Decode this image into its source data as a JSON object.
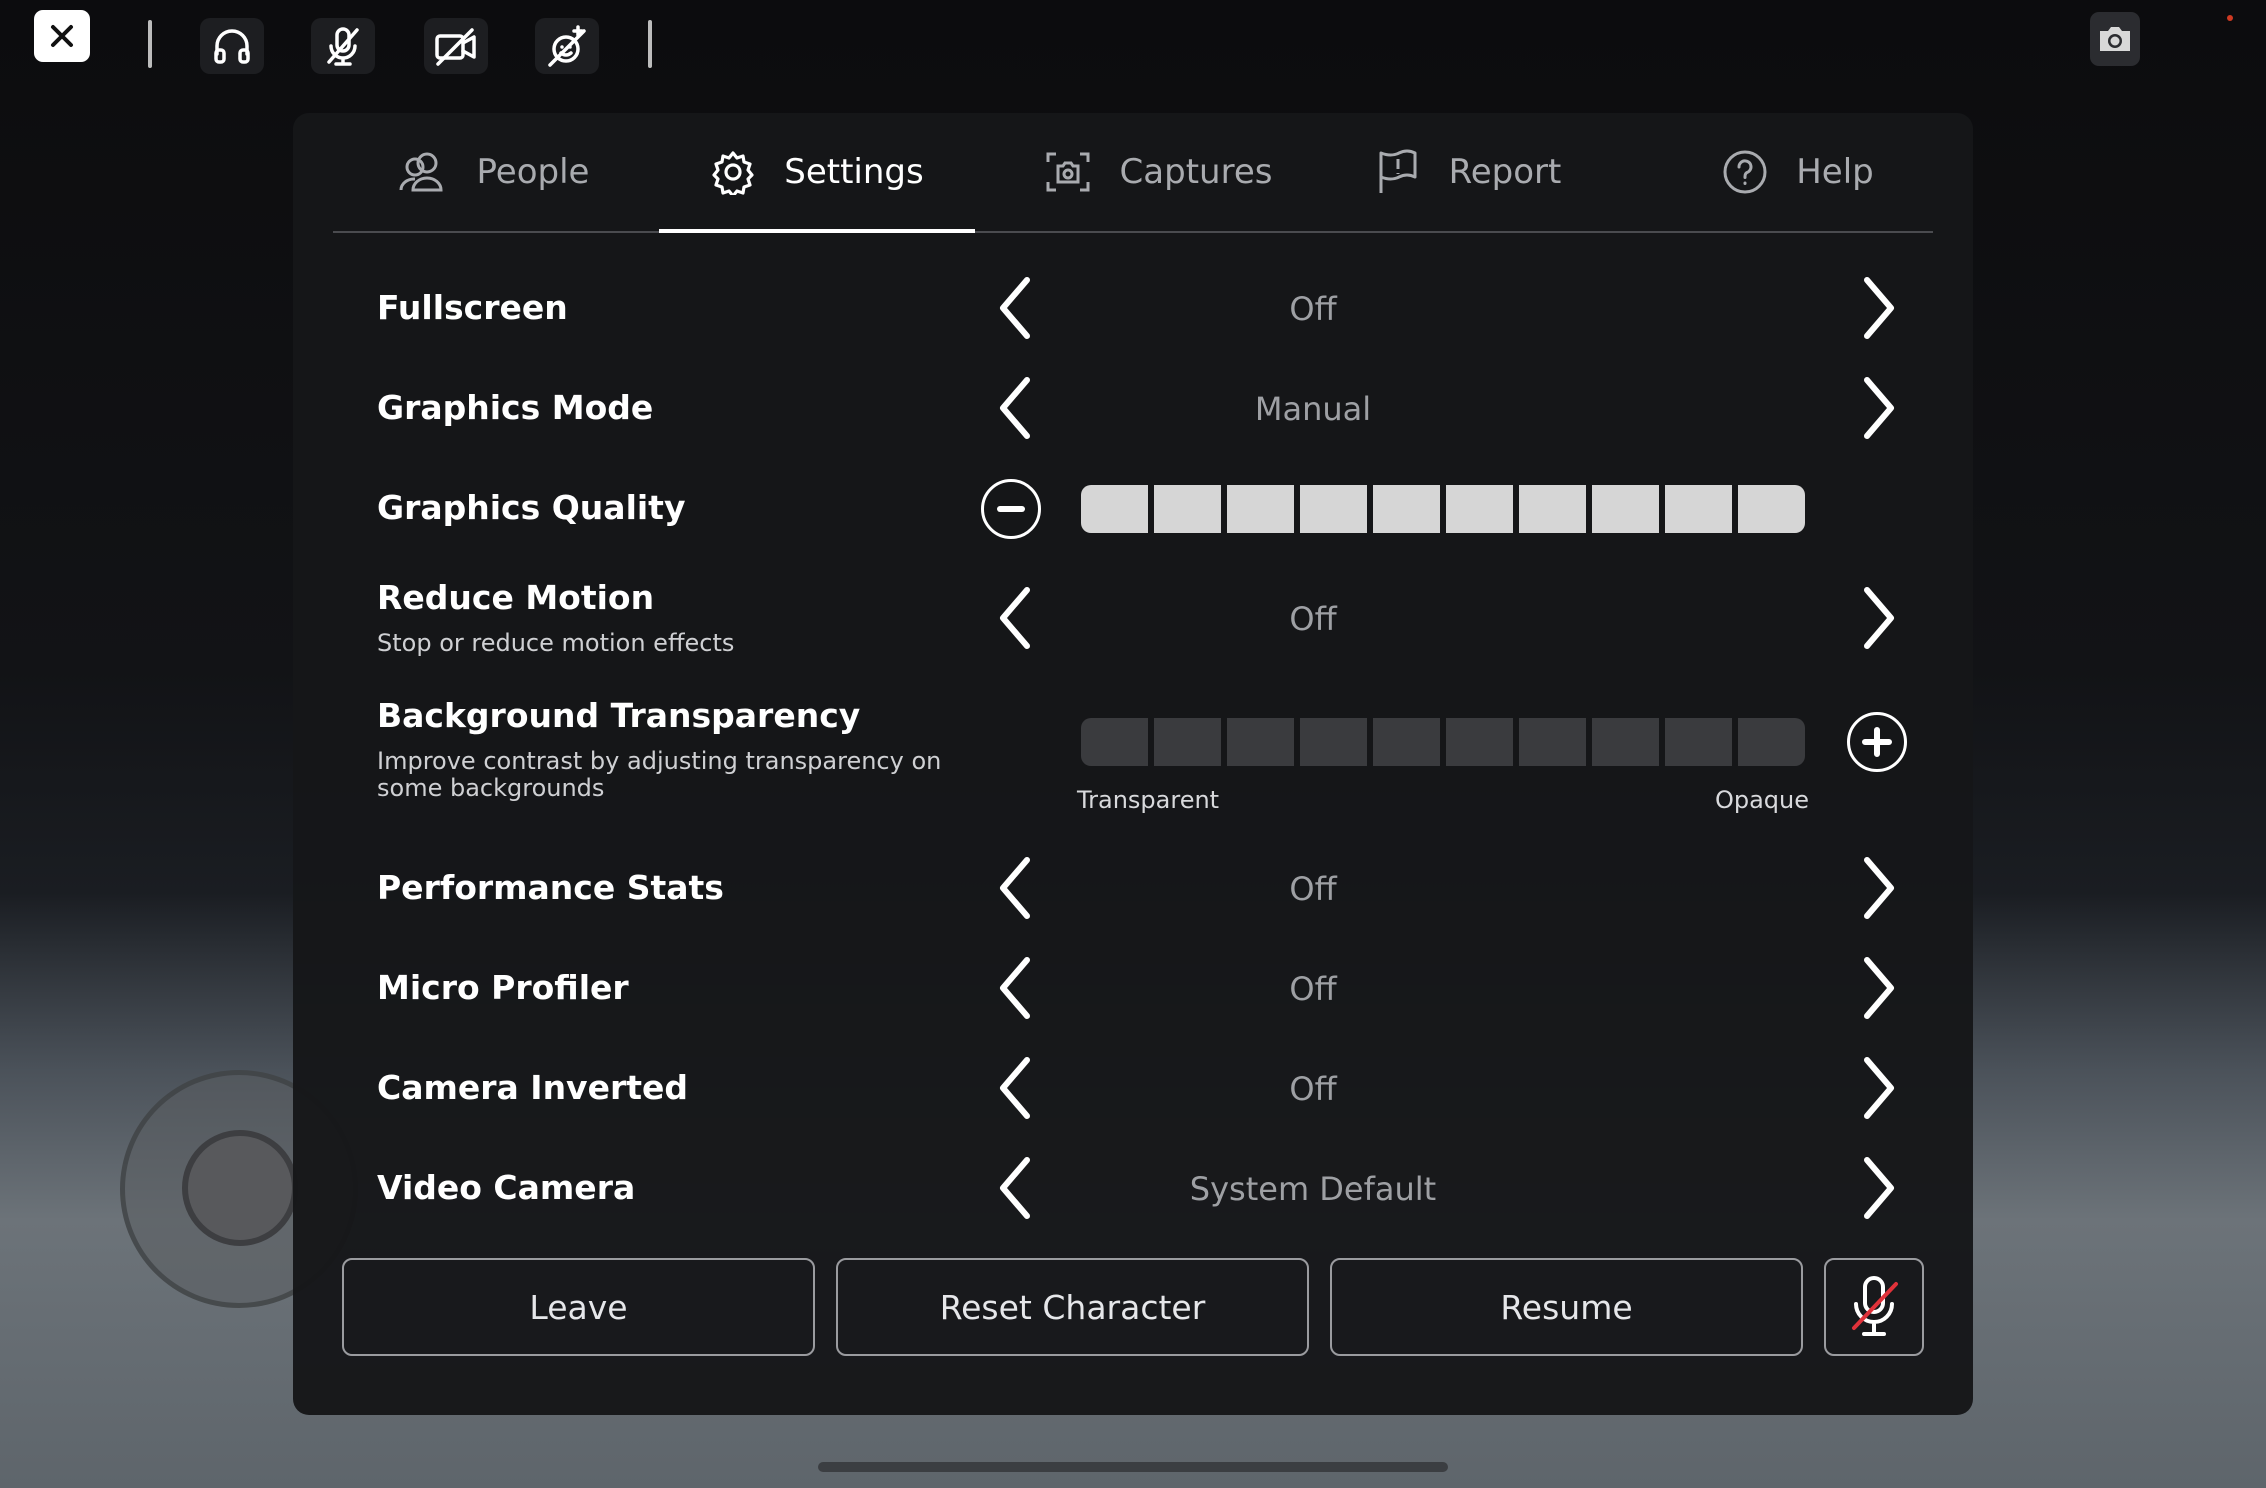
{
  "tabs": [
    {
      "label": "People",
      "icon": "people-icon"
    },
    {
      "label": "Settings",
      "icon": "gear-icon"
    },
    {
      "label": "Captures",
      "icon": "capture-icon"
    },
    {
      "label": "Report",
      "icon": "flag-icon"
    },
    {
      "label": "Help",
      "icon": "help-icon"
    }
  ],
  "active_tab": "Settings",
  "settings": {
    "fullscreen": {
      "label": "Fullscreen",
      "value": "Off"
    },
    "graphics_mode": {
      "label": "Graphics Mode",
      "value": "Manual"
    },
    "graphics_quality": {
      "label": "Graphics Quality",
      "level": 10,
      "max": 10
    },
    "reduce_motion": {
      "label": "Reduce Motion",
      "description": "Stop or reduce motion effects",
      "value": "Off"
    },
    "background_transparency": {
      "label": "Background Transparency",
      "description": "Improve contrast by adjusting transparency on some backgrounds",
      "level": 0,
      "max": 10,
      "min_label": "Transparent",
      "max_label": "Opaque"
    },
    "performance_stats": {
      "label": "Performance Stats",
      "value": "Off"
    },
    "micro_profiler": {
      "label": "Micro Profiler",
      "value": "Off"
    },
    "camera_inverted": {
      "label": "Camera Inverted",
      "value": "Off"
    },
    "video_camera": {
      "label": "Video Camera",
      "value": "System Default"
    }
  },
  "buttons": {
    "leave": "Leave",
    "reset_character": "Reset Character",
    "resume": "Resume"
  },
  "colors": {
    "panel_bg": "#161719",
    "slider_on": "#d6d6d6",
    "slider_off": "#3a3b3e",
    "mic_muted_slash": "#e0323a",
    "record_dot": "#cf3a22"
  }
}
